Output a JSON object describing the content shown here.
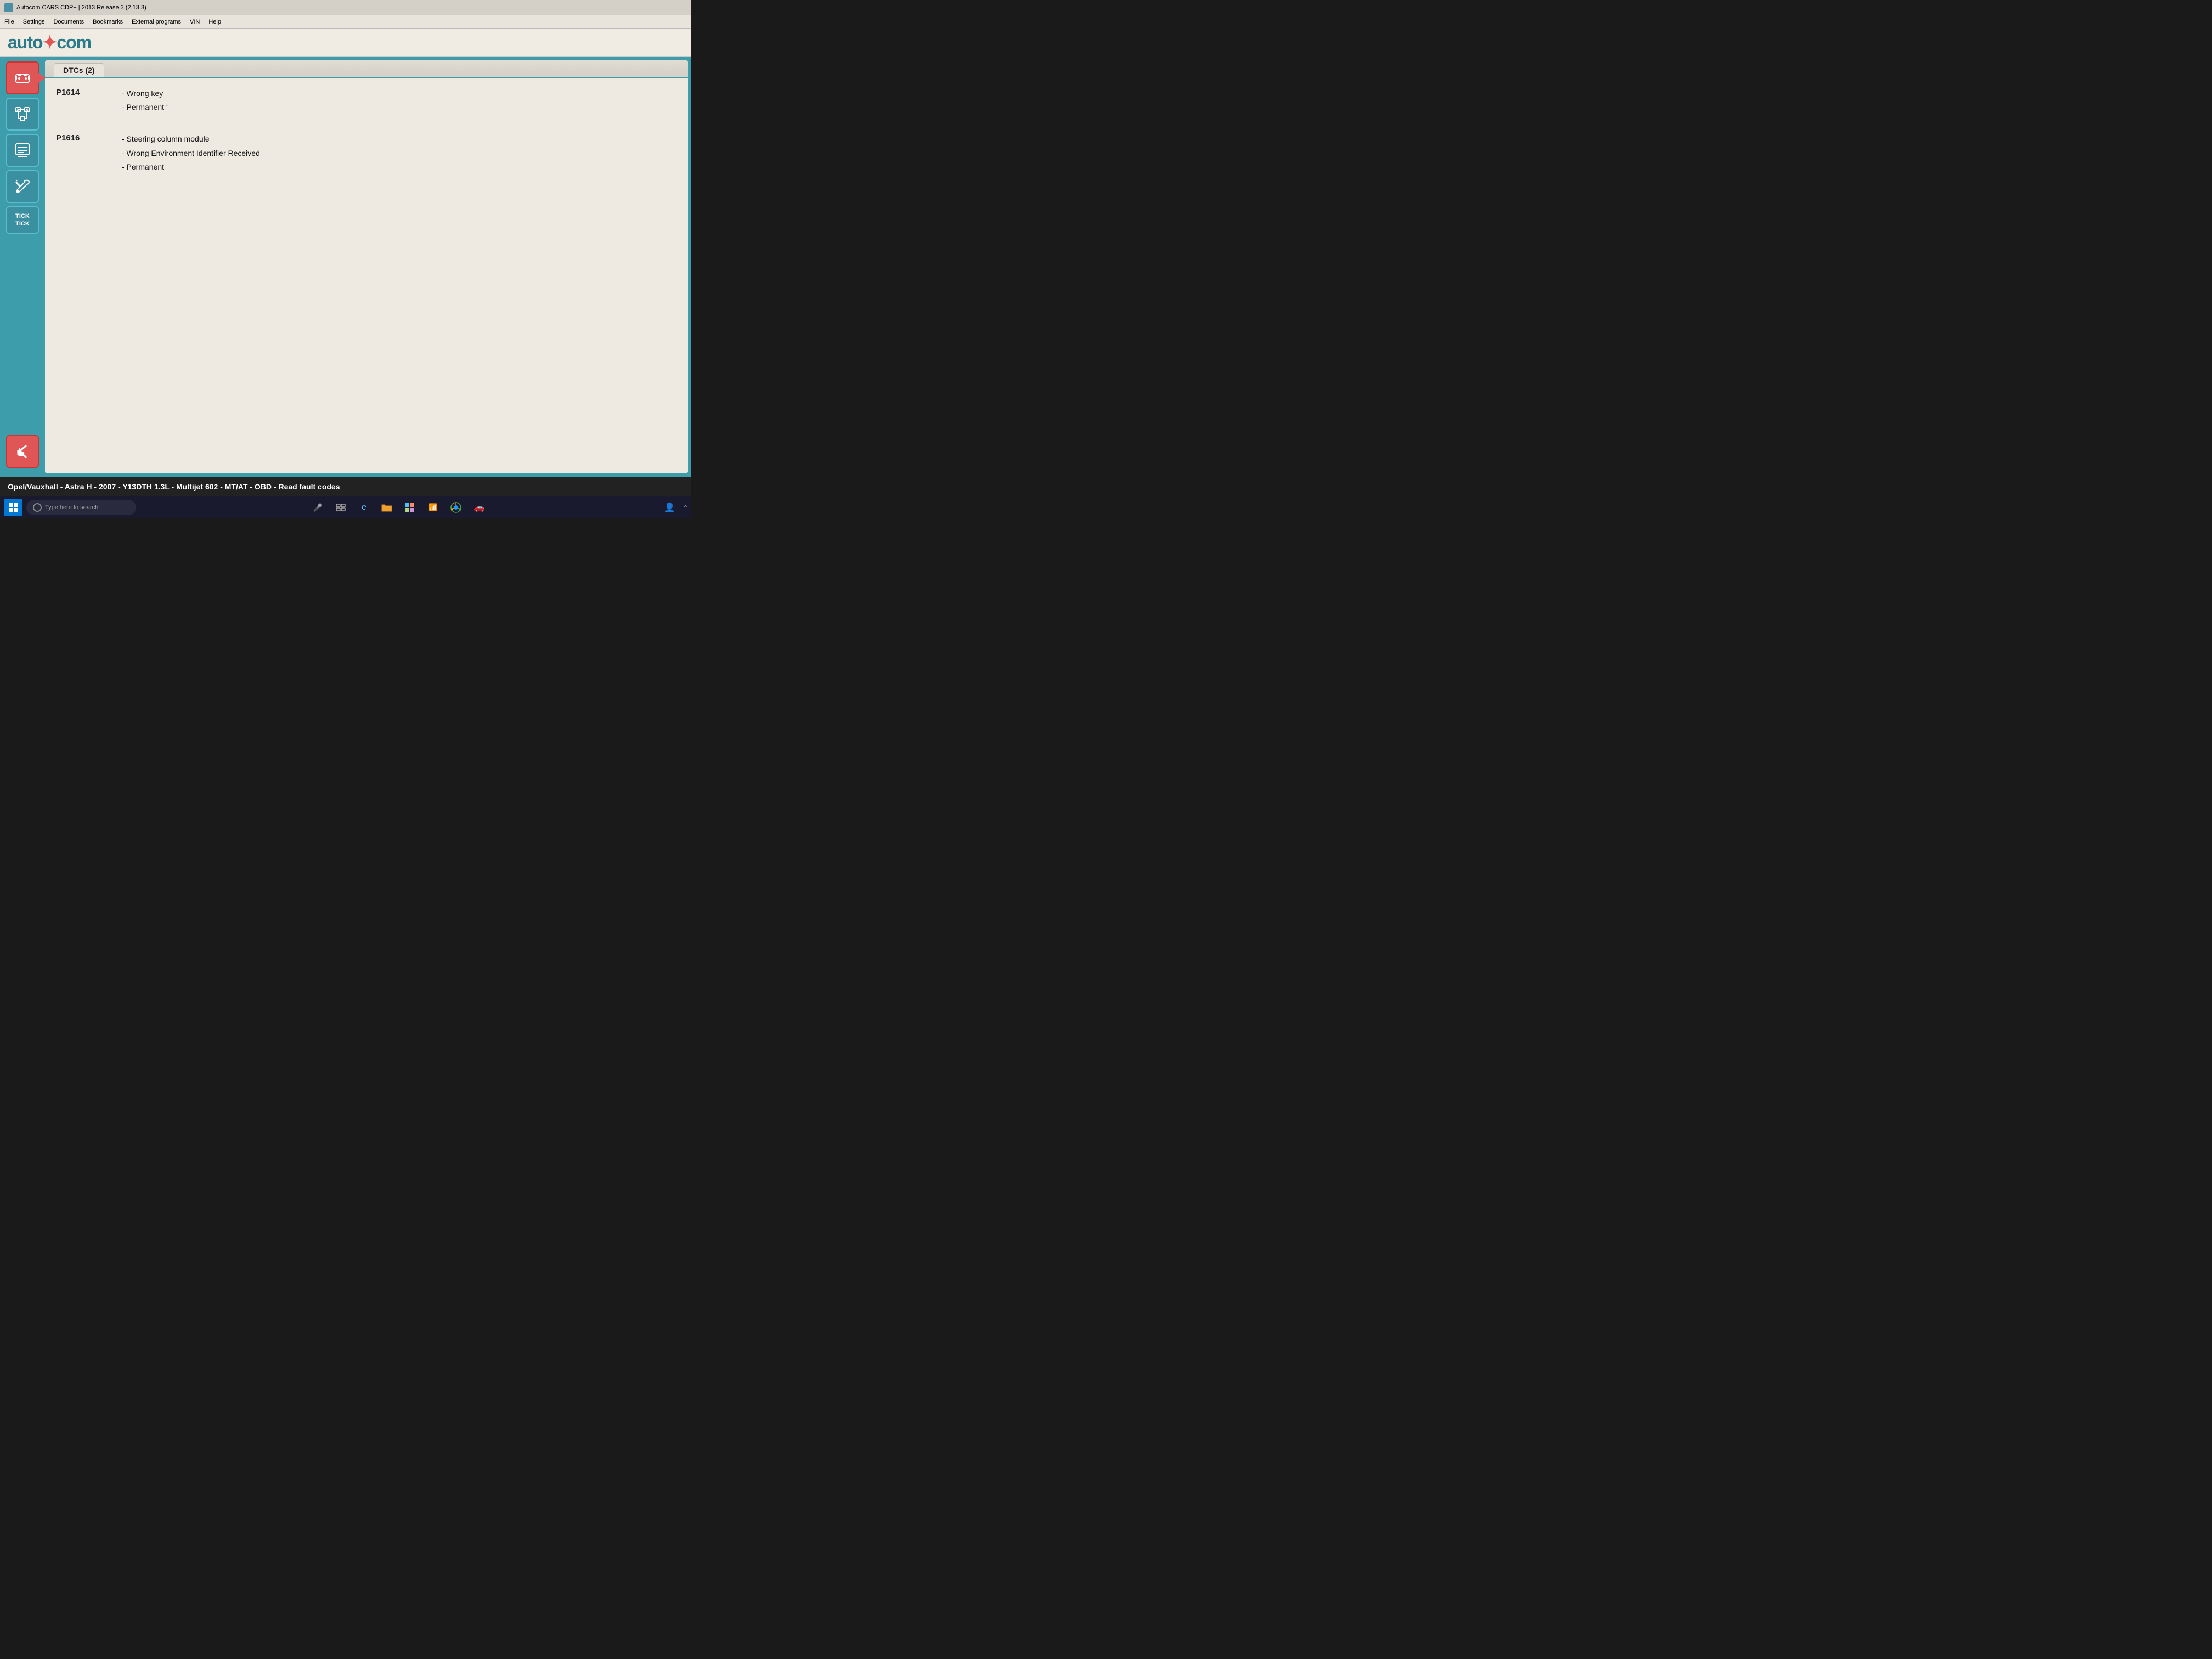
{
  "titleBar": {
    "icon": "autocom-icon",
    "text": "Autocom CARS CDP+ | 2013 Release 3 (2.13.3)"
  },
  "menuBar": {
    "items": [
      "File",
      "Settings",
      "Documents",
      "Bookmarks",
      "External programs",
      "VIN",
      "Help"
    ]
  },
  "logo": {
    "text": "auto",
    "textAccent": "com",
    "fullText": "autocom"
  },
  "tab": {
    "label": "DTCs (2)"
  },
  "dtcs": [
    {
      "code": "P1614",
      "details": [
        "- Wrong key",
        "- Permanent ʻ"
      ]
    },
    {
      "code": "P1616",
      "details": [
        "- Steering column module",
        "- Wrong Environment Identifier Received",
        "- Permanent"
      ]
    }
  ],
  "sidebar": {
    "buttons": [
      {
        "name": "engine-icon",
        "active": true
      },
      {
        "name": "transmission-icon",
        "active": false
      },
      {
        "name": "display-icon",
        "active": false
      },
      {
        "name": "tools-icon",
        "active": false
      }
    ],
    "tickTick": "Tick TicK",
    "tickLine1": "TICK",
    "tickLine2": "TICK"
  },
  "statusBar": {
    "text": "Opel/Vauxhall - Astra H - 2007 - Y13DTH 1.3L - Multijet 602 - MT/AT - OBD - Read fault codes"
  },
  "taskbar": {
    "searchPlaceholder": "Type here to search",
    "icons": [
      "microphone",
      "task-view",
      "edge",
      "folder",
      "store",
      "network",
      "chrome",
      "car-app",
      "person"
    ]
  }
}
